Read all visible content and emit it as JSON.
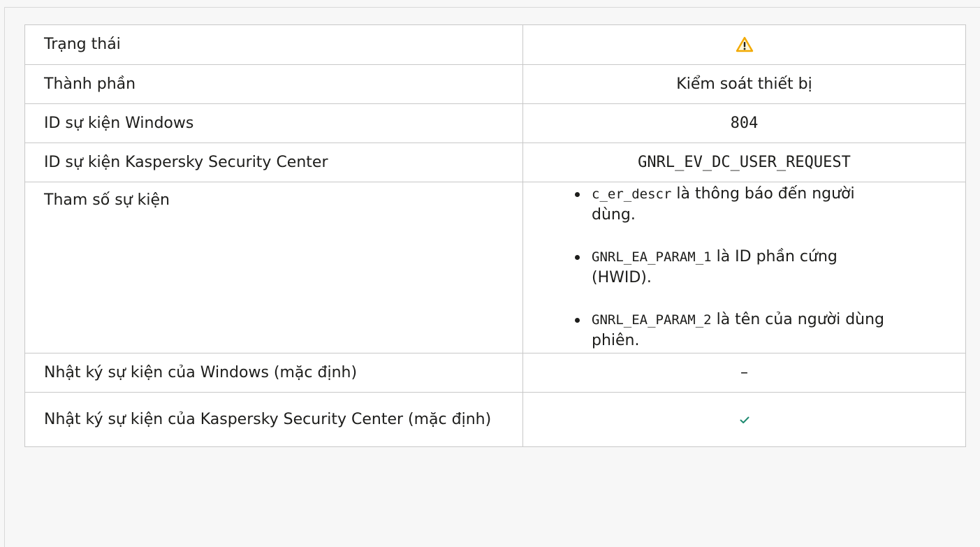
{
  "status_colors": {
    "warning": "#f2a900",
    "success": "#1f8a70"
  },
  "rows": {
    "status": {
      "label": "Trạng thái",
      "icon": "warning-icon"
    },
    "component": {
      "label": "Thành phần",
      "value": "Kiểm soát thiết bị"
    },
    "windows_event_id": {
      "label": "ID sự kiện Windows",
      "value": "804"
    },
    "ksc_event_id": {
      "label": "ID sự kiện Kaspersky Security Center",
      "value": "GNRL_EV_DC_USER_REQUEST"
    },
    "event_params": {
      "label": "Tham số sự kiện",
      "items": [
        {
          "code": "c_er_descr",
          "text": " là thông báo đến người dùng."
        },
        {
          "code": "GNRL_EA_PARAM_1",
          "text": " là ID phần cứng (HWID)."
        },
        {
          "code": "GNRL_EA_PARAM_2",
          "text": " là tên của người dùng phiên."
        }
      ]
    },
    "windows_log": {
      "label": "Nhật ký sự kiện của Windows (mặc định)",
      "value": "–"
    },
    "ksc_log": {
      "label": "Nhật ký sự kiện của Kaspersky Security Center (mặc định)",
      "icon": "check-icon"
    }
  }
}
